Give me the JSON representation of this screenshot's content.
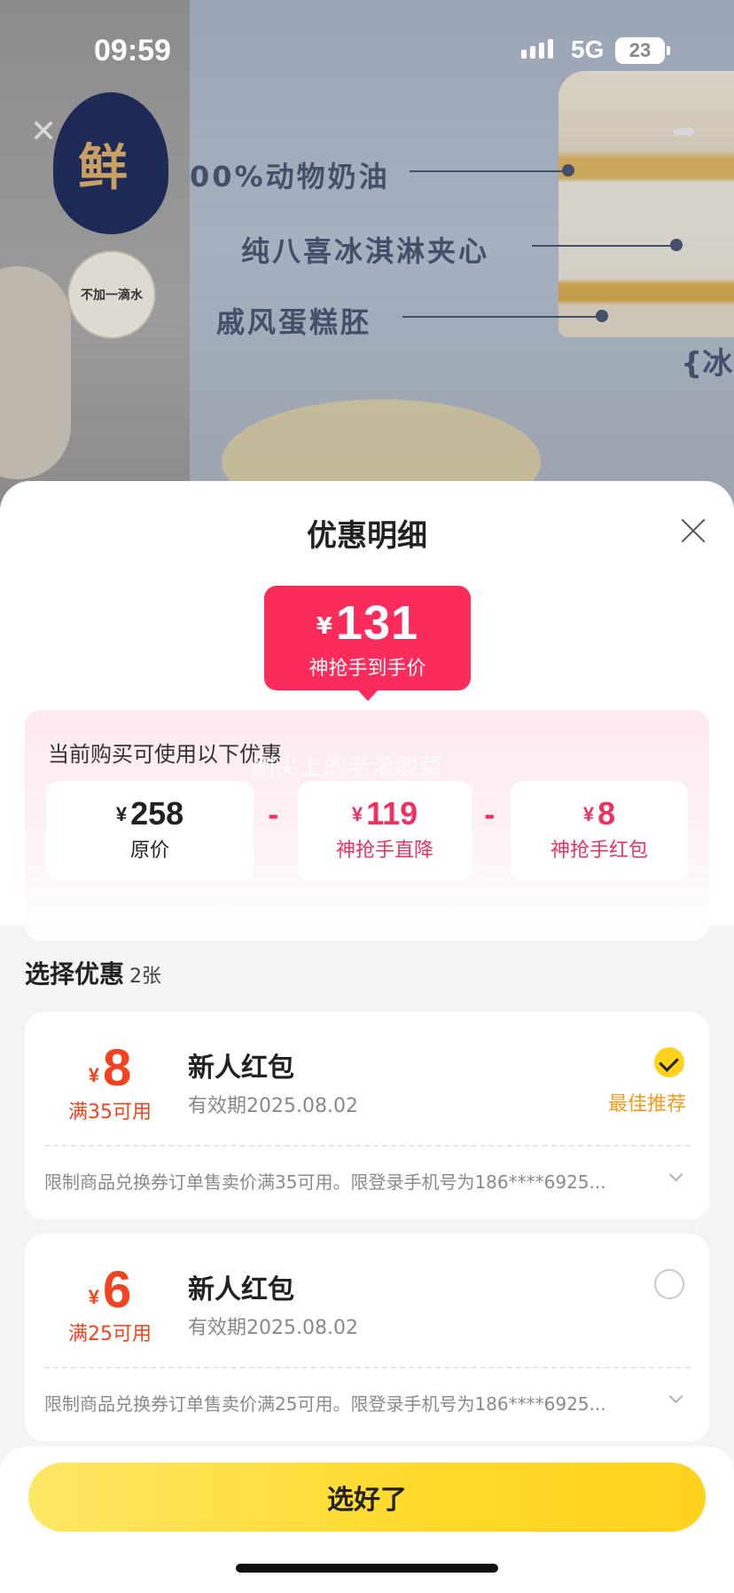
{
  "status_bar": {
    "time": "09:59",
    "network": "5G",
    "battery": "23"
  },
  "background": {
    "badge_fresh": "鲜",
    "badge_water": "不加一滴水",
    "features": [
      "00%动物奶油",
      "纯八喜冰淇淋夹心",
      "戚风蛋糕胚"
    ],
    "brace_text": "{冰"
  },
  "sheet": {
    "title": "优惠明细",
    "final_price": {
      "currency": "¥",
      "amount": "131",
      "label": "神抢手到手价"
    },
    "discount_panel": {
      "title": "当前购买可使用以下优惠",
      "watermark": "刷尖上的老滚酸菜",
      "items": [
        {
          "currency": "¥",
          "value": "258",
          "label": "原价",
          "color": "#222222"
        },
        {
          "currency": "¥",
          "value": "119",
          "label": "神抢手直降",
          "color": "#f0305f"
        },
        {
          "currency": "¥",
          "value": "8",
          "label": "神抢手红包",
          "color": "#f0305f"
        }
      ],
      "operator": "-"
    },
    "select_header": {
      "title": "选择优惠",
      "count": "2张"
    },
    "coupons": [
      {
        "currency": "¥",
        "amount": "8",
        "condition": "满35可用",
        "name": "新人红包",
        "expire": "有效期2025.08.02",
        "selected": true,
        "tag": "最佳推荐",
        "rule": "限制商品兑换券订单售卖价满35可用。限登录手机号为186****6925..."
      },
      {
        "currency": "¥",
        "amount": "6",
        "condition": "满25可用",
        "name": "新人红包",
        "expire": "有效期2025.08.02",
        "selected": false,
        "tag": "",
        "rule": "限制商品兑换券订单售卖价满25可用。限登录手机号为186****6925..."
      }
    ],
    "confirm_label": "选好了"
  },
  "colors": {
    "accent_pink": "#fb2c5c",
    "coupon_red": "#f5421e",
    "confirm_yellow": "#ffd21e",
    "best_orange": "#f59a1b"
  }
}
